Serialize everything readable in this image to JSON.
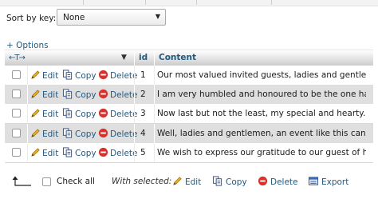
{
  "sort": {
    "label": "Sort by key:",
    "selected": "None"
  },
  "options_link": "+ Options",
  "header": {
    "col_id": "id",
    "col_content": "Content"
  },
  "actions": {
    "edit": "Edit",
    "copy": "Copy",
    "delete": "Delete"
  },
  "rows": [
    {
      "id": "1",
      "content": "Our most valued invited guests, ladies and gentlem..."
    },
    {
      "id": "2",
      "content": "I am very humbled and honoured to be the one havin..."
    },
    {
      "id": "3",
      "content": "Now last but not the least, my special and hearty..."
    },
    {
      "id": "4",
      "content": "Well, ladies and gentlemen, an event like this can..."
    },
    {
      "id": "5",
      "content": "We wish to express our gratitude to our guest of h..."
    }
  ],
  "footer": {
    "check_all": "Check all",
    "with_selected": "With selected:",
    "edit": "Edit",
    "copy": "Copy",
    "delete": "Delete",
    "export": "Export"
  },
  "icons": {
    "edit": "pencil-icon",
    "copy": "copy-icon",
    "delete": "delete-icon",
    "export": "export-icon",
    "column_arrows": "column-arrows-icon",
    "column_menu": "dropdown-triangle-icon",
    "check_all_arrow": "corner-arrow-icon"
  },
  "colors": {
    "link": "#235a81",
    "row_alt": "#dfdfdf",
    "delete_red": "#d9312b"
  }
}
